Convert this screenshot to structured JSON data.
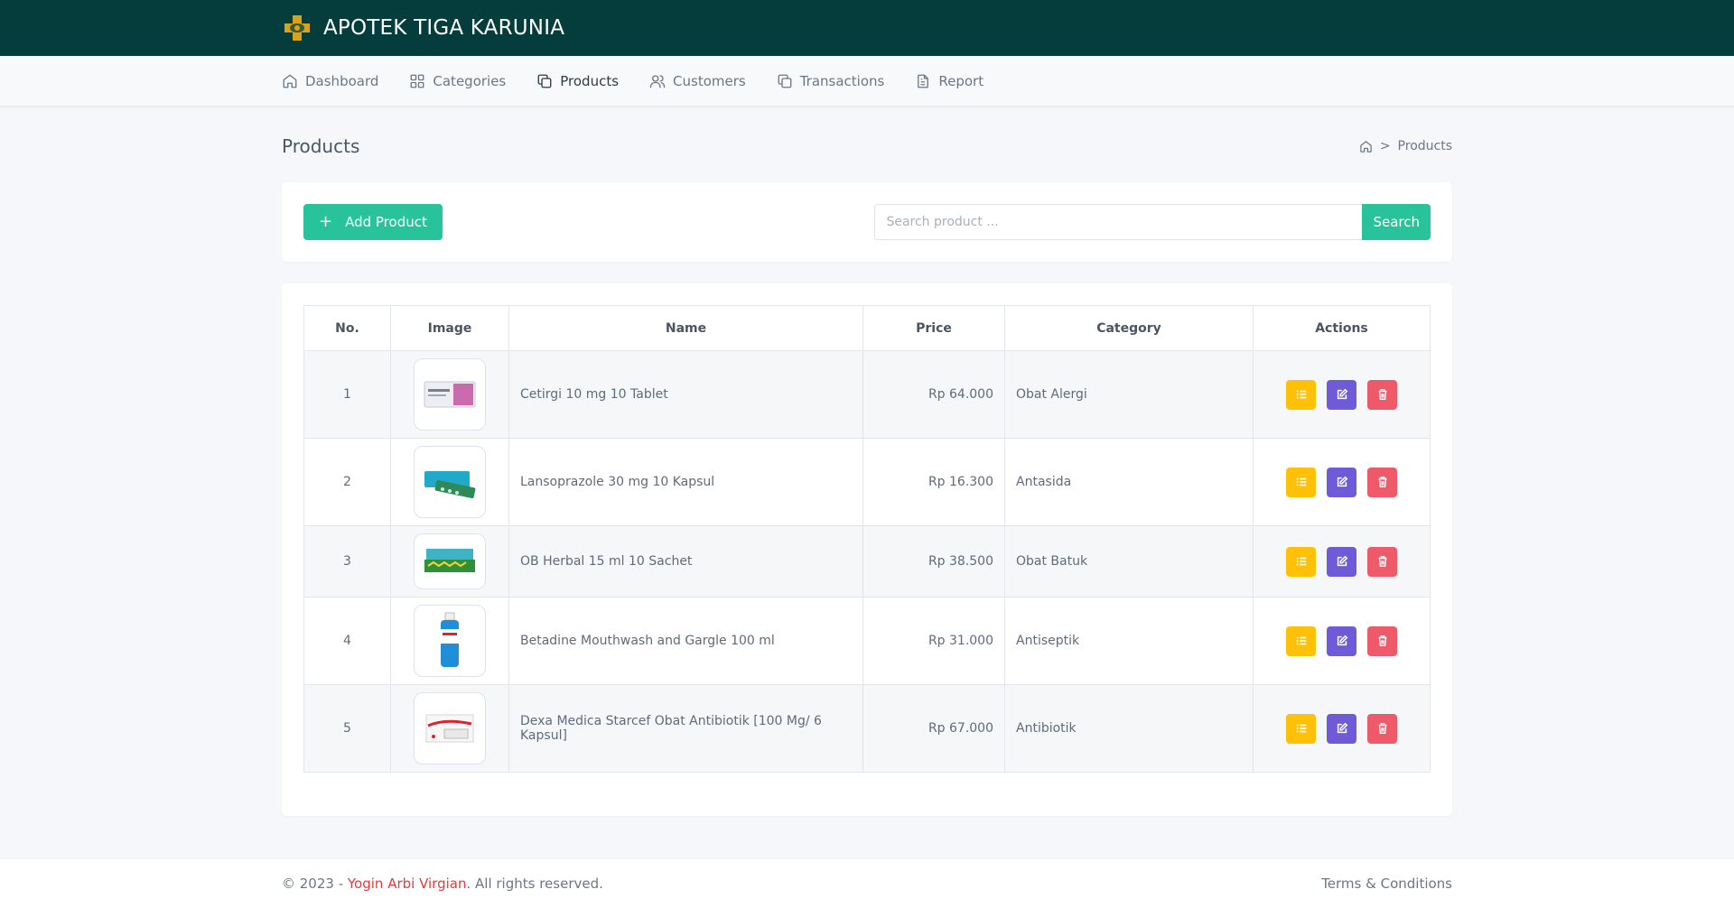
{
  "brand": {
    "title": "APOTEK TIGA KARUNIA",
    "logo_icon": "pharmacy-cross-icon",
    "logo_color": "#d9a21b"
  },
  "nav": {
    "items": [
      {
        "label": "Dashboard",
        "icon": "home-icon",
        "active": false
      },
      {
        "label": "Categories",
        "icon": "grid-icon",
        "active": false
      },
      {
        "label": "Products",
        "icon": "copy-icon",
        "active": true
      },
      {
        "label": "Customers",
        "icon": "users-icon",
        "active": false
      },
      {
        "label": "Transactions",
        "icon": "copy-icon",
        "active": false
      },
      {
        "label": "Report",
        "icon": "file-text-icon",
        "active": false
      }
    ]
  },
  "page": {
    "title": "Products",
    "breadcrumb_sep": ">",
    "breadcrumb_current": "Products"
  },
  "toolbar": {
    "add_label": "Add Product",
    "add_icon": "+",
    "search_placeholder": "Search product ...",
    "search_label": "Search"
  },
  "table": {
    "headers": {
      "no": "No.",
      "image": "Image",
      "name": "Name",
      "price": "Price",
      "category": "Category",
      "actions": "Actions"
    },
    "rows": [
      {
        "no": "1",
        "name": "Cetirgi 10 mg 10 Tablet",
        "price": "Rp 64.000",
        "category": "Obat Alergi"
      },
      {
        "no": "2",
        "name": "Lansoprazole 30 mg 10 Kapsul",
        "price": "Rp 16.300",
        "category": "Antasida"
      },
      {
        "no": "3",
        "name": "OB Herbal 15 ml 10 Sachet",
        "price": "Rp 38.500",
        "category": "Obat Batuk"
      },
      {
        "no": "4",
        "name": "Betadine Mouthwash and Gargle 100 ml",
        "price": "Rp 31.000",
        "category": "Antiseptik"
      },
      {
        "no": "5",
        "name": "Dexa Medica Starcef Obat Antibiotik [100 Mg/ 6 Kapsul]",
        "price": "Rp 67.000",
        "category": "Antibiotik"
      }
    ]
  },
  "footer": {
    "copyright_prefix": "© 2023 - ",
    "author": "Yogin Arbi Virgian",
    "copyright_suffix": ". All rights reserved.",
    "terms": "Terms & Conditions"
  },
  "colors": {
    "header_bg": "#053d3d",
    "primary": "#28c39a",
    "detail": "#ffc107",
    "edit": "#6f5bd7",
    "delete": "#ef5a6a",
    "author": "#e5393b"
  }
}
